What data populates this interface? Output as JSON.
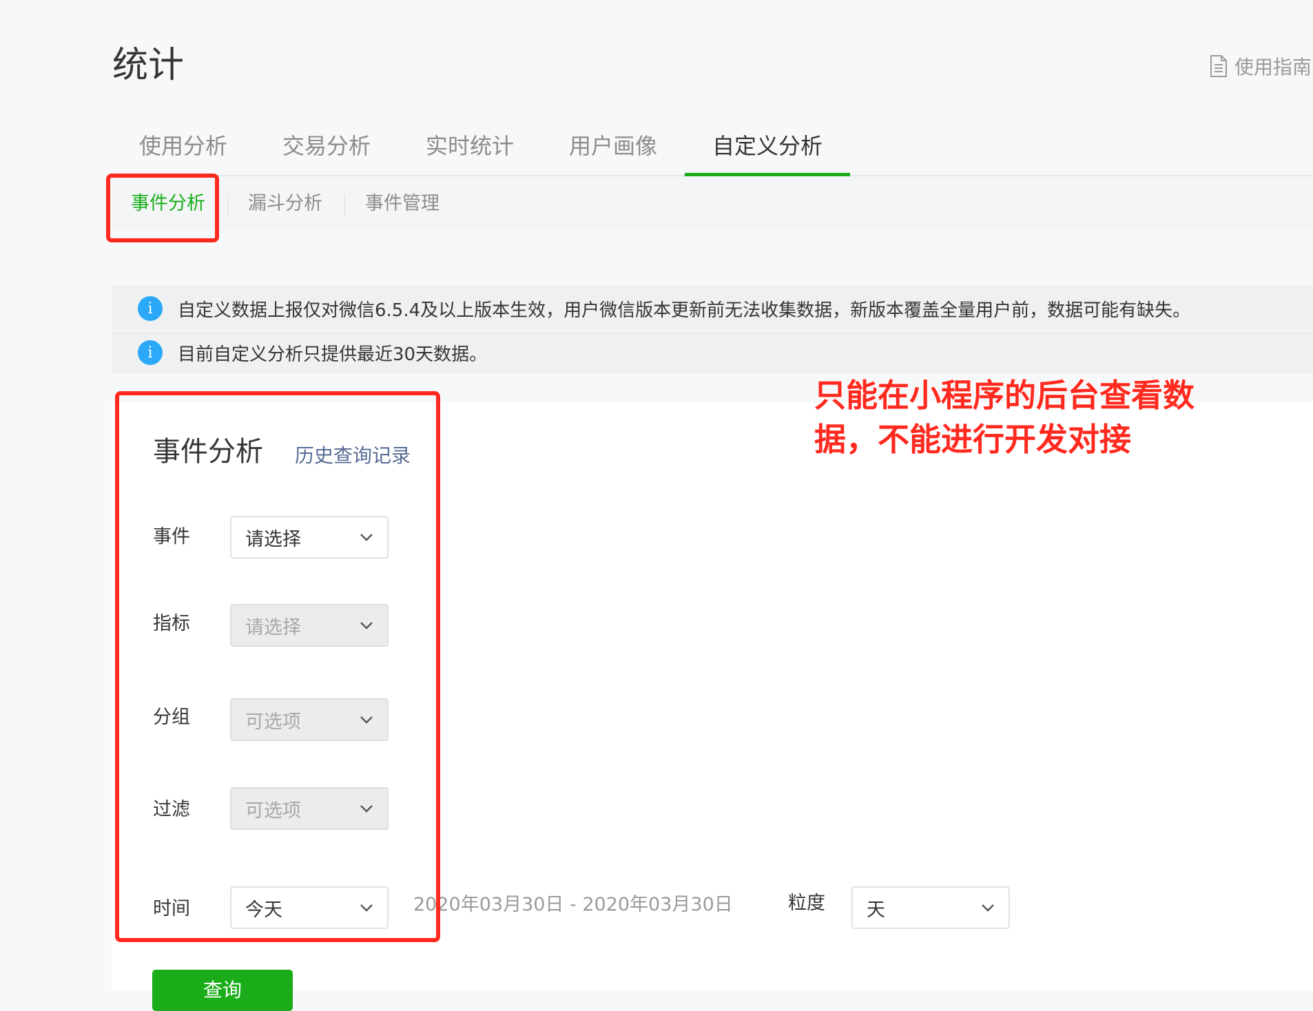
{
  "header": {
    "title": "统计",
    "guide_label": "使用指南"
  },
  "tabs": [
    {
      "label": "使用分析"
    },
    {
      "label": "交易分析"
    },
    {
      "label": "实时统计"
    },
    {
      "label": "用户画像"
    },
    {
      "label": "自定义分析",
      "active": true
    }
  ],
  "subtabs": [
    {
      "label": "事件分析",
      "active": true
    },
    {
      "label": "漏斗分析"
    },
    {
      "label": "事件管理"
    }
  ],
  "notices": [
    "自定义数据上报仅对微信6.5.4及以上版本生效，用户微信版本更新前无法收集数据，新版本覆盖全量用户前，数据可能有缺失。",
    "目前自定义分析只提供最近30天数据。"
  ],
  "panel": {
    "title": "事件分析",
    "history_link": "历史查询记录",
    "fields": {
      "event": {
        "label": "事件",
        "value": "请选择"
      },
      "metric": {
        "label": "指标",
        "value": "请选择"
      },
      "group": {
        "label": "分组",
        "value": "可选项"
      },
      "filter": {
        "label": "过滤",
        "value": "可选项"
      },
      "time": {
        "label": "时间",
        "value": "今天"
      }
    },
    "date_range": "2020年03月30日 - 2020年03月30日",
    "granularity": {
      "label": "粒度",
      "value": "天"
    },
    "query_button": "查询"
  },
  "annotation": {
    "text": "只能在小程序的后台查看数据，不能进行开发对接",
    "color": "#ff2a1f"
  },
  "colors": {
    "accent": "#1aad19",
    "link": "#576b95",
    "info": "#2ba8f7",
    "highlight": "#ff2a1f"
  }
}
